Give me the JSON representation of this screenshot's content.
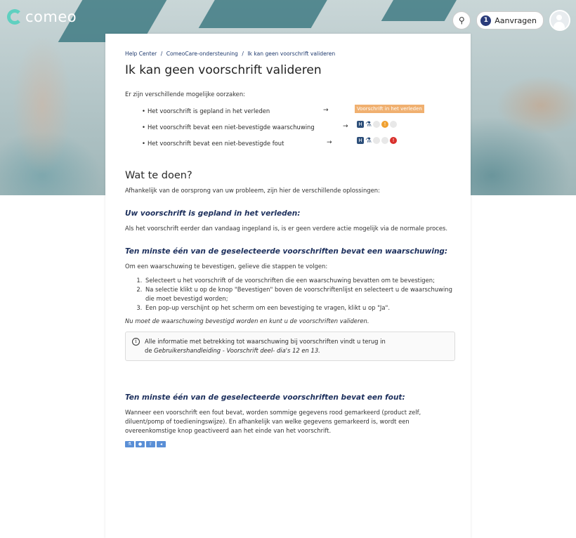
{
  "header": {
    "logo_text": "comeo",
    "search_icon": "search-icon",
    "requests_count": "1",
    "requests_label": "Aanvragen",
    "avatar_icon": "user-icon"
  },
  "breadcrumb": [
    "Help Center",
    "/",
    "ComeoCare-ondersteuning",
    "/",
    "Ik kan geen voorschrift valideren"
  ],
  "title": "Ik kan geen voorschrift valideren",
  "intro": "Er zijn verschillende mogelijke oorzaken:",
  "causes": [
    {
      "text": "Het voorschrift is gepland in het verleden",
      "tag": "Voorschrift in het verleden"
    },
    {
      "text": "Het voorschrift bevat een niet-bevestigde waarschuwing",
      "icons": [
        "hospital",
        "flask",
        "empty",
        "warning",
        "empty"
      ]
    },
    {
      "text": "Het voorschrift bevat een niet-bevestigde fout",
      "icons": [
        "hospital",
        "flask",
        "empty",
        "empty",
        "error"
      ]
    }
  ],
  "arrow": "→",
  "todo_title": "Wat te doen?",
  "todo_intro": "Afhankelijk van de oorsprong van uw probleem, zijn hier de verschillende oplossingen:",
  "section1": {
    "title": "Uw voorschrift is gepland in het verleden:",
    "body": "Als het voorschrift eerder dan vandaag ingepland is, is er geen verdere actie mogelijk via de normale proces."
  },
  "section2": {
    "title": "Ten minste één van de geselecteerde voorschriften bevat een waarschuwing:",
    "intro": "Om een waarschuwing te bevestigen, gelieve die stappen te volgen:",
    "steps": [
      "Selecteert u het voorschrift of de voorschriften die een waarschuwing bevatten om te bevestigen;",
      "Na selectie klikt u op de knop \"Bevestigen\" boven de voorschriftenlijst en selecteert u de waarschuwing die moet bevestigd worden;",
      "Een pop-up verschijnt op het scherm om een bevestiging te vragen, klikt u op \"Ja\"."
    ],
    "note": "Nu moet de waarschuwing bevestigd worden en kunt u de voorschriften valideren.",
    "info_line1": "Alle informatie met betrekking tot waarschuwing bij voorschriften vindt u terug in",
    "info_line2_prefix": "de ",
    "info_line2_link": "Gebruikershandleiding - Voorschrift deel- dia's 12 en 13."
  },
  "section3": {
    "title": "Ten minste één van de geselecteerde voorschriften bevat een fout:",
    "body": "Wanneer een voorschrift een fout bevat, worden sommige gegevens rood gemarkeerd (product zelf, diluent/pomp of toedieningswijze). En afhankelijk van welke gegevens gemarkeerd is, wordt een overeenkomstige knop geactiveerd aan het einde van het voorschrift.",
    "tool_icons": [
      "flask-icon",
      "drop-icon",
      "upload-icon",
      "sound-icon"
    ]
  }
}
